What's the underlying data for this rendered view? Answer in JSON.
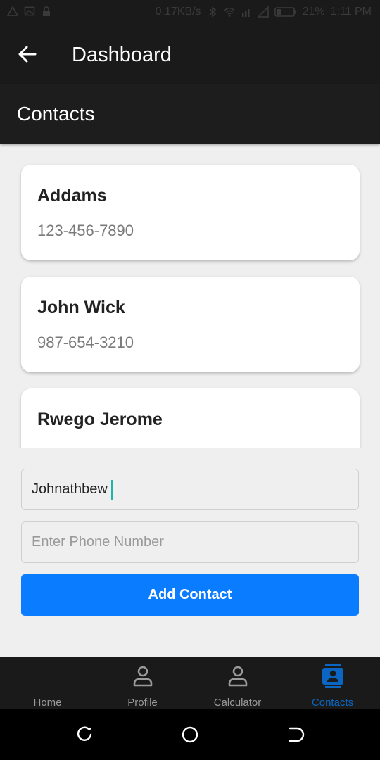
{
  "status_bar": {
    "speed": "0.17KB/s",
    "battery": "21%",
    "time": "1:11 PM"
  },
  "header": {
    "title": "Dashboard",
    "subtitle": "Contacts"
  },
  "contacts": [
    {
      "name": "Addams",
      "phone": "123-456-7890"
    },
    {
      "name": "John Wick",
      "phone": "987-654-3210"
    },
    {
      "name": "Rwego Jerome",
      "phone": ""
    }
  ],
  "form": {
    "name_value": "Johnathbew",
    "phone_value": "",
    "phone_placeholder": "Enter Phone Number",
    "submit_label": "Add Contact"
  },
  "nav": {
    "items": [
      {
        "label": "Home",
        "icon": "home-icon",
        "active": false
      },
      {
        "label": "Profile",
        "icon": "person-icon",
        "active": false
      },
      {
        "label": "Calculator",
        "icon": "person-icon",
        "active": false
      },
      {
        "label": "Contacts",
        "icon": "contacts-icon",
        "active": true
      }
    ],
    "active_color": "#0a66c2",
    "inactive_color": "#9a9a9a"
  },
  "colors": {
    "accent": "#0a7cff",
    "app_bar": "#1a1a1a"
  }
}
